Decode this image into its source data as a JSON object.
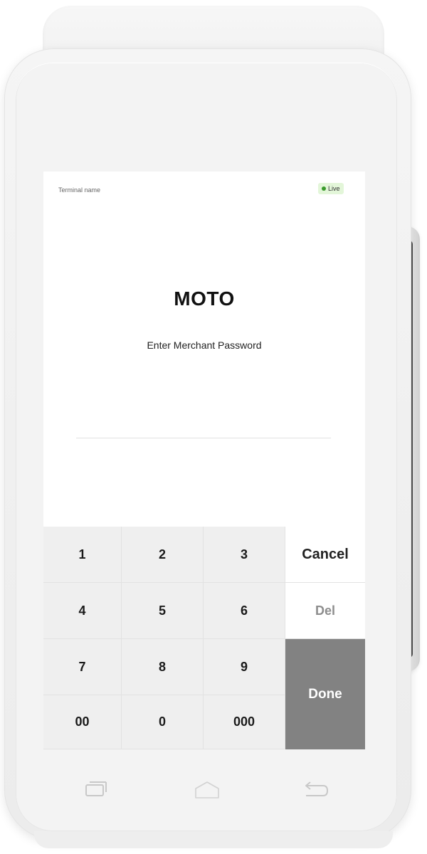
{
  "status_bar": {
    "terminal_name": "Terminal name",
    "live_label": "Live",
    "live_color": "#3a9a2c",
    "live_bg": "#e3f6d9"
  },
  "main": {
    "title": "MOTO",
    "prompt": "Enter Merchant Password",
    "password_value": "",
    "password_placeholder": ""
  },
  "keypad": {
    "keys": [
      "1",
      "2",
      "3",
      "4",
      "5",
      "6",
      "7",
      "8",
      "9",
      "00",
      "0",
      "000"
    ],
    "cancel_label": "Cancel",
    "del_label": "Del",
    "done_label": "Done",
    "done_color": "#828282"
  },
  "nav_bar": {
    "icons": [
      "recent-apps-icon",
      "home-icon",
      "back-icon"
    ]
  }
}
